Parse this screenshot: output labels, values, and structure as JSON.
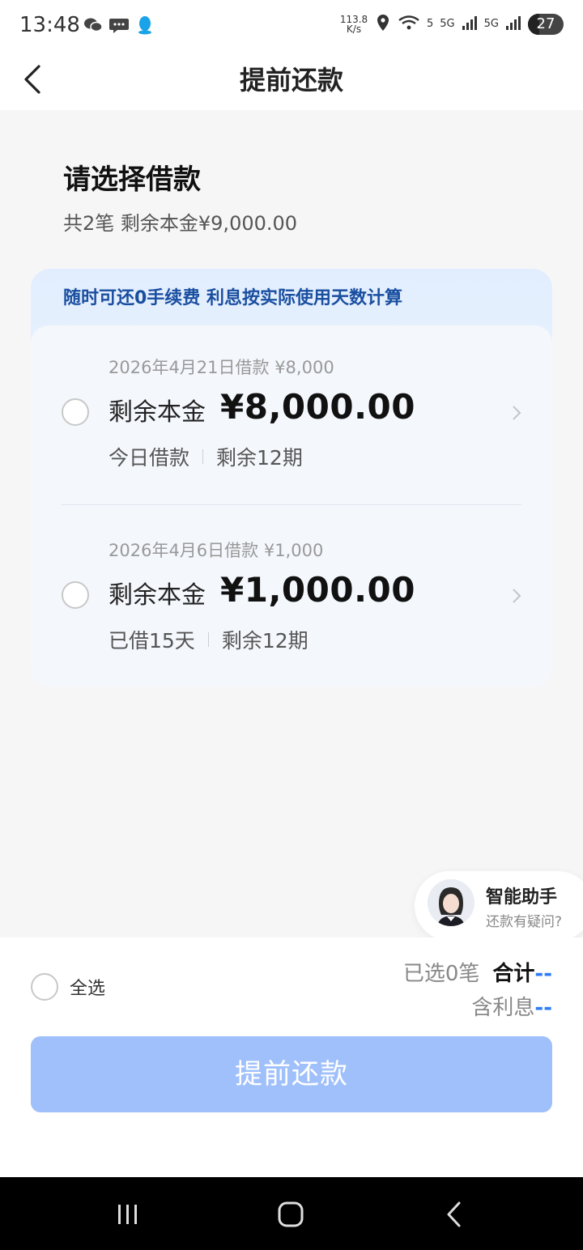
{
  "status_bar": {
    "time": "13:48",
    "net_speed_value": "113.8",
    "net_speed_unit": "K/s",
    "wifi_label": "5",
    "signal1_label": "5G",
    "signal2_label": "5G",
    "battery": "27"
  },
  "header": {
    "title": "提前还款"
  },
  "section": {
    "title": "请选择借款",
    "summary": "共2笔 剩余本金¥9,000.00"
  },
  "card": {
    "banner": "随时可还0手续费 利息按实际使用天数计算"
  },
  "loans": [
    {
      "date_line": "2026年4月21日借款 ¥8,000",
      "label": "剩余本金",
      "amount": "¥8,000.00",
      "meta_left": "今日借款",
      "meta_right": "剩余12期"
    },
    {
      "date_line": "2026年4月6日借款 ¥1,000",
      "label": "剩余本金",
      "amount": "¥1,000.00",
      "meta_left": "已借15天",
      "meta_right": "剩余12期"
    }
  ],
  "assistant": {
    "name": "智能助手",
    "subtitle": "还款有疑问?"
  },
  "footer": {
    "select_all": "全选",
    "selected_count": "已选0笔",
    "total_label": "合计",
    "total_value": "--",
    "interest_label": "含利息",
    "interest_value": "--",
    "button_label": "提前还款"
  },
  "colors": {
    "accent": "#2f7df6",
    "button_disabled": "#a0c0fb",
    "banner_text": "#1a4fa0"
  }
}
